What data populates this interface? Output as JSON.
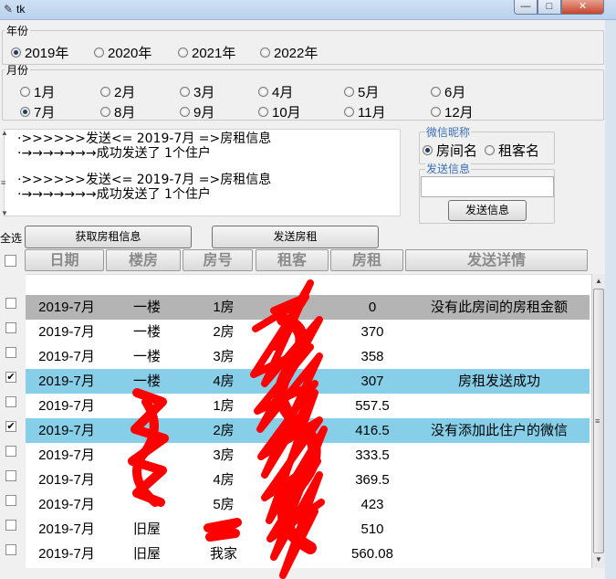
{
  "window": {
    "title": "tk",
    "min_glyph": "—",
    "max_glyph": "□",
    "close_glyph": "✕"
  },
  "year_group": {
    "label": "年份",
    "options": [
      "2019年",
      "2020年",
      "2021年",
      "2022年"
    ],
    "selected": "2019年"
  },
  "month_group": {
    "label": "月份",
    "options": [
      "1月",
      "2月",
      "3月",
      "4月",
      "5月",
      "6月",
      "7月",
      "8月",
      "9月",
      "10月",
      "11月",
      "12月"
    ],
    "selected": "7月"
  },
  "log": {
    "lines": [
      "·>>>>>>发送<= 2019-7月 =>房租信息",
      "·→→→→→→→成功发送了 1个住户",
      "·>>>>>>发送<= 2019-7月 =>房租信息",
      "·→→→→→→→成功发送了 1个住户"
    ]
  },
  "wechat": {
    "nick_label": "微信昵称",
    "options": [
      "房间名",
      "租客名"
    ],
    "selected": "房间名",
    "send_info_label": "发送信息",
    "send_input_value": "",
    "send_button": "发送信息"
  },
  "toolbar": {
    "select_all": "全选",
    "fetch_button": "获取房租信息",
    "send_rent_button": "发送房租"
  },
  "table": {
    "columns": [
      "日期",
      "楼房",
      "房号",
      "租客",
      "房租",
      "发送详情"
    ],
    "rows": [
      {
        "date": "2019-7月",
        "building": "一楼",
        "room": "1房",
        "tenant": "",
        "rent": "0",
        "detail": "没有此房间的房租金额",
        "checked": false,
        "highlight": "gray"
      },
      {
        "date": "2019-7月",
        "building": "一楼",
        "room": "2房",
        "tenant": "",
        "rent": "370",
        "detail": "",
        "checked": false,
        "highlight": "none"
      },
      {
        "date": "2019-7月",
        "building": "一楼",
        "room": "3房",
        "tenant": "",
        "rent": "358",
        "detail": "",
        "checked": false,
        "highlight": "none"
      },
      {
        "date": "2019-7月",
        "building": "一楼",
        "room": "4房",
        "tenant": "",
        "rent": "307",
        "detail": "房租发送成功",
        "checked": true,
        "highlight": "blue"
      },
      {
        "date": "2019-7月",
        "building": "",
        "room": "1房",
        "tenant": "",
        "rent": "557.5",
        "detail": "",
        "checked": false,
        "highlight": "none"
      },
      {
        "date": "2019-7月",
        "building": "",
        "room": "2房",
        "tenant": "",
        "rent": "416.5",
        "detail": "没有添加此住户的微信",
        "checked": true,
        "highlight": "blue"
      },
      {
        "date": "2019-7月",
        "building": "",
        "room": "3房",
        "tenant": "",
        "rent": "333.5",
        "detail": "",
        "checked": false,
        "highlight": "none"
      },
      {
        "date": "2019-7月",
        "building": "",
        "room": "4房",
        "tenant": "",
        "rent": "369.5",
        "detail": "",
        "checked": false,
        "highlight": "none"
      },
      {
        "date": "2019-7月",
        "building": "",
        "room": "5房",
        "tenant": "",
        "rent": "423",
        "detail": "",
        "checked": false,
        "highlight": "none"
      },
      {
        "date": "2019-7月",
        "building": "旧屋",
        "room": "",
        "tenant": "",
        "rent": "510",
        "detail": "",
        "checked": false,
        "highlight": "none"
      },
      {
        "date": "2019-7月",
        "building": "旧屋",
        "room": "我家",
        "tenant": "",
        "rent": "560.08",
        "detail": "",
        "checked": false,
        "highlight": "none"
      }
    ]
  },
  "colors": {
    "row_gray": "#b4b4b4",
    "row_blue": "#87cfe8",
    "redaction": "#ff0000"
  }
}
